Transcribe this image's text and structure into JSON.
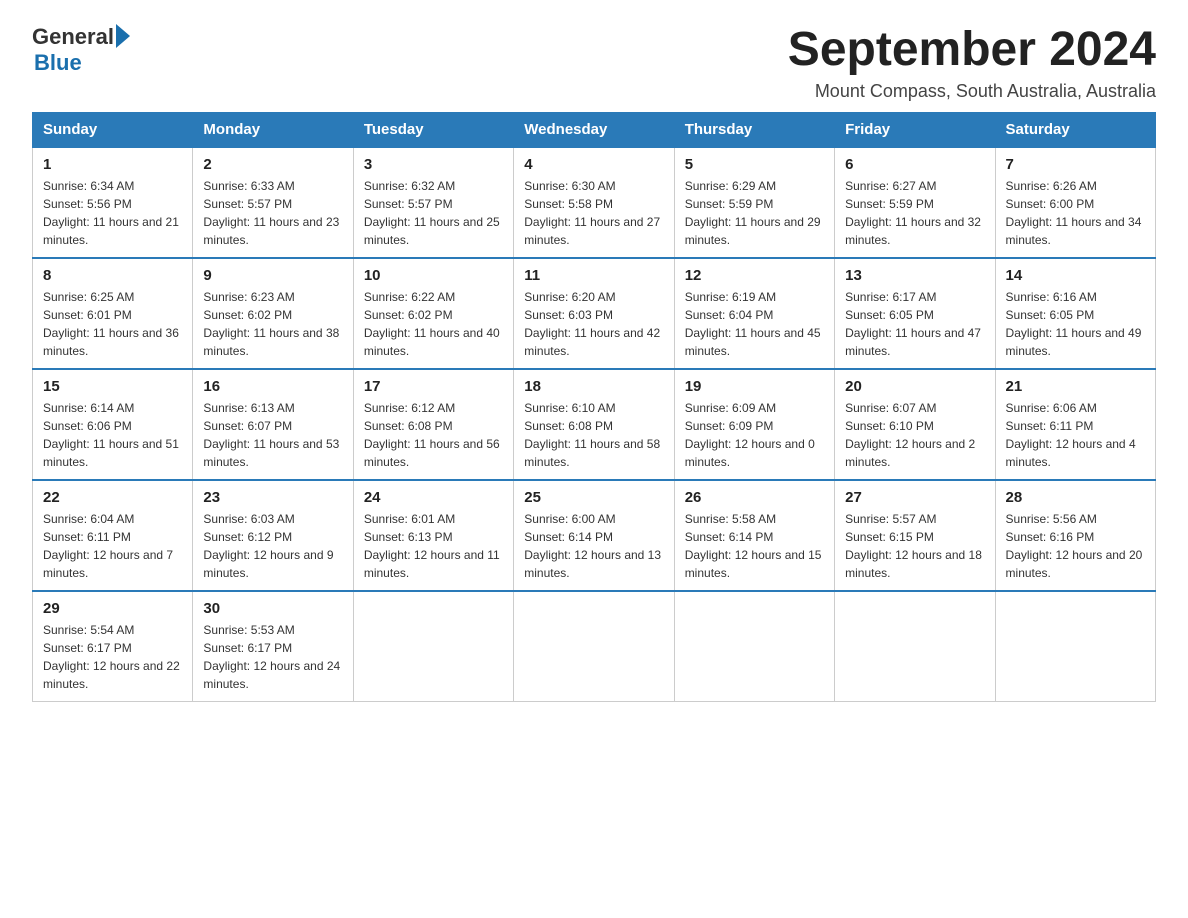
{
  "logo": {
    "general": "General",
    "blue": "Blue"
  },
  "title": "September 2024",
  "location": "Mount Compass, South Australia, Australia",
  "days_of_week": [
    "Sunday",
    "Monday",
    "Tuesday",
    "Wednesday",
    "Thursday",
    "Friday",
    "Saturday"
  ],
  "weeks": [
    [
      {
        "day": "1",
        "sunrise": "6:34 AM",
        "sunset": "5:56 PM",
        "daylight": "11 hours and 21 minutes."
      },
      {
        "day": "2",
        "sunrise": "6:33 AM",
        "sunset": "5:57 PM",
        "daylight": "11 hours and 23 minutes."
      },
      {
        "day": "3",
        "sunrise": "6:32 AM",
        "sunset": "5:57 PM",
        "daylight": "11 hours and 25 minutes."
      },
      {
        "day": "4",
        "sunrise": "6:30 AM",
        "sunset": "5:58 PM",
        "daylight": "11 hours and 27 minutes."
      },
      {
        "day": "5",
        "sunrise": "6:29 AM",
        "sunset": "5:59 PM",
        "daylight": "11 hours and 29 minutes."
      },
      {
        "day": "6",
        "sunrise": "6:27 AM",
        "sunset": "5:59 PM",
        "daylight": "11 hours and 32 minutes."
      },
      {
        "day": "7",
        "sunrise": "6:26 AM",
        "sunset": "6:00 PM",
        "daylight": "11 hours and 34 minutes."
      }
    ],
    [
      {
        "day": "8",
        "sunrise": "6:25 AM",
        "sunset": "6:01 PM",
        "daylight": "11 hours and 36 minutes."
      },
      {
        "day": "9",
        "sunrise": "6:23 AM",
        "sunset": "6:02 PM",
        "daylight": "11 hours and 38 minutes."
      },
      {
        "day": "10",
        "sunrise": "6:22 AM",
        "sunset": "6:02 PM",
        "daylight": "11 hours and 40 minutes."
      },
      {
        "day": "11",
        "sunrise": "6:20 AM",
        "sunset": "6:03 PM",
        "daylight": "11 hours and 42 minutes."
      },
      {
        "day": "12",
        "sunrise": "6:19 AM",
        "sunset": "6:04 PM",
        "daylight": "11 hours and 45 minutes."
      },
      {
        "day": "13",
        "sunrise": "6:17 AM",
        "sunset": "6:05 PM",
        "daylight": "11 hours and 47 minutes."
      },
      {
        "day": "14",
        "sunrise": "6:16 AM",
        "sunset": "6:05 PM",
        "daylight": "11 hours and 49 minutes."
      }
    ],
    [
      {
        "day": "15",
        "sunrise": "6:14 AM",
        "sunset": "6:06 PM",
        "daylight": "11 hours and 51 minutes."
      },
      {
        "day": "16",
        "sunrise": "6:13 AM",
        "sunset": "6:07 PM",
        "daylight": "11 hours and 53 minutes."
      },
      {
        "day": "17",
        "sunrise": "6:12 AM",
        "sunset": "6:08 PM",
        "daylight": "11 hours and 56 minutes."
      },
      {
        "day": "18",
        "sunrise": "6:10 AM",
        "sunset": "6:08 PM",
        "daylight": "11 hours and 58 minutes."
      },
      {
        "day": "19",
        "sunrise": "6:09 AM",
        "sunset": "6:09 PM",
        "daylight": "12 hours and 0 minutes."
      },
      {
        "day": "20",
        "sunrise": "6:07 AM",
        "sunset": "6:10 PM",
        "daylight": "12 hours and 2 minutes."
      },
      {
        "day": "21",
        "sunrise": "6:06 AM",
        "sunset": "6:11 PM",
        "daylight": "12 hours and 4 minutes."
      }
    ],
    [
      {
        "day": "22",
        "sunrise": "6:04 AM",
        "sunset": "6:11 PM",
        "daylight": "12 hours and 7 minutes."
      },
      {
        "day": "23",
        "sunrise": "6:03 AM",
        "sunset": "6:12 PM",
        "daylight": "12 hours and 9 minutes."
      },
      {
        "day": "24",
        "sunrise": "6:01 AM",
        "sunset": "6:13 PM",
        "daylight": "12 hours and 11 minutes."
      },
      {
        "day": "25",
        "sunrise": "6:00 AM",
        "sunset": "6:14 PM",
        "daylight": "12 hours and 13 minutes."
      },
      {
        "day": "26",
        "sunrise": "5:58 AM",
        "sunset": "6:14 PM",
        "daylight": "12 hours and 15 minutes."
      },
      {
        "day": "27",
        "sunrise": "5:57 AM",
        "sunset": "6:15 PM",
        "daylight": "12 hours and 18 minutes."
      },
      {
        "day": "28",
        "sunrise": "5:56 AM",
        "sunset": "6:16 PM",
        "daylight": "12 hours and 20 minutes."
      }
    ],
    [
      {
        "day": "29",
        "sunrise": "5:54 AM",
        "sunset": "6:17 PM",
        "daylight": "12 hours and 22 minutes."
      },
      {
        "day": "30",
        "sunrise": "5:53 AM",
        "sunset": "6:17 PM",
        "daylight": "12 hours and 24 minutes."
      },
      null,
      null,
      null,
      null,
      null
    ]
  ]
}
